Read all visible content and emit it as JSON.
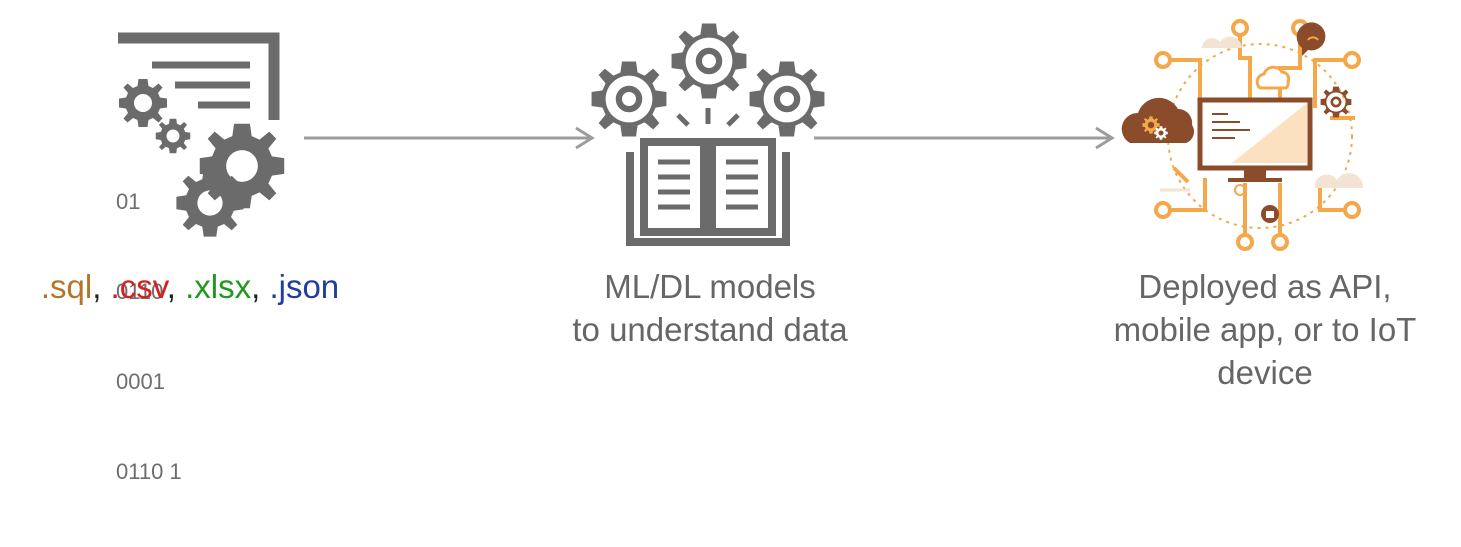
{
  "colors": {
    "icon_gray": "#6b6b6b",
    "arrow_gray": "#9c9c9c",
    "text_gray": "#666666",
    "orange": "#f5a84a",
    "brown": "#8a4c2a",
    "sql": "#b8732a",
    "csv": "#d42020",
    "xlsx": "#1f9a1f",
    "json": "#1f3f9a"
  },
  "stages": [
    {
      "icon": "data-file-gears-icon",
      "binary_lines": [
        "01",
        "0110",
        "0001",
        "0110 1"
      ],
      "formats": [
        {
          "label": ".sql",
          "color": "#b8732a"
        },
        {
          "label": ".csv",
          "color": "#d42020"
        },
        {
          "label": ".xlsx",
          "color": "#1f9a1f"
        },
        {
          "label": ".json",
          "color": "#1f3f9a"
        }
      ],
      "separator": ", "
    },
    {
      "icon": "book-gears-icon",
      "caption_lines": [
        "ML/DL models",
        "to understand data"
      ]
    },
    {
      "icon": "connected-computer-icon",
      "caption_lines": [
        "Deployed as API,",
        "mobile app, or to IoT",
        "device"
      ]
    }
  ]
}
